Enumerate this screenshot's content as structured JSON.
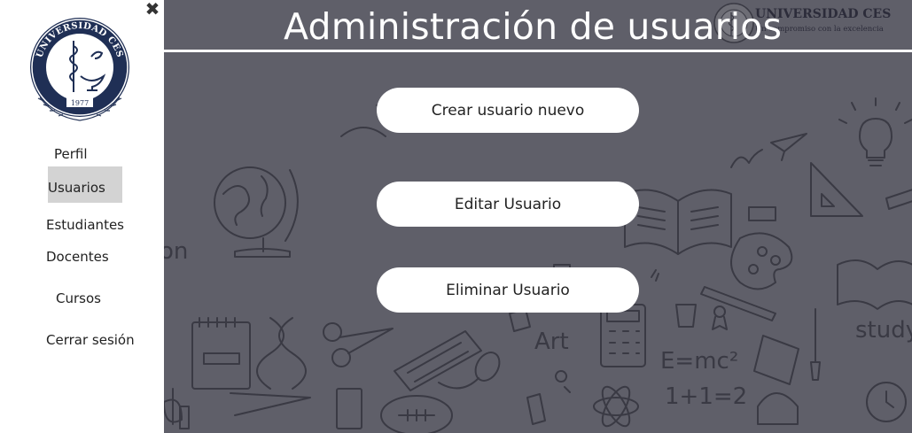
{
  "sidebar": {
    "close_icon": "close-icon",
    "logo": {
      "text_top": "UNIVERSIDAD CES",
      "year": "1977"
    },
    "items": [
      {
        "label": "Perfil"
      },
      {
        "label": "Usuarios",
        "active": true
      },
      {
        "label": "Estudiantes"
      },
      {
        "label": "Docentes"
      },
      {
        "label": "Cursos"
      },
      {
        "label": "Cerrar sesión"
      }
    ]
  },
  "header": {
    "title": "Administración de usuarios",
    "university_name": "UNIVERSIDAD CES",
    "university_slogan": "Un compromiso con la excelencia"
  },
  "actions": [
    {
      "label": "Crear usuario nuevo"
    },
    {
      "label": "Editar Usuario"
    },
    {
      "label": "Eliminar Usuario"
    }
  ],
  "background": {
    "doodle_texts": [
      "on",
      "Art",
      "E=mc²",
      "1+1=2",
      "study"
    ]
  },
  "colors": {
    "main_bg": "#5f5f69",
    "doodle": "#3a3a44",
    "button_bg": "#ffffff",
    "active_nav": "#d3d3d3"
  }
}
